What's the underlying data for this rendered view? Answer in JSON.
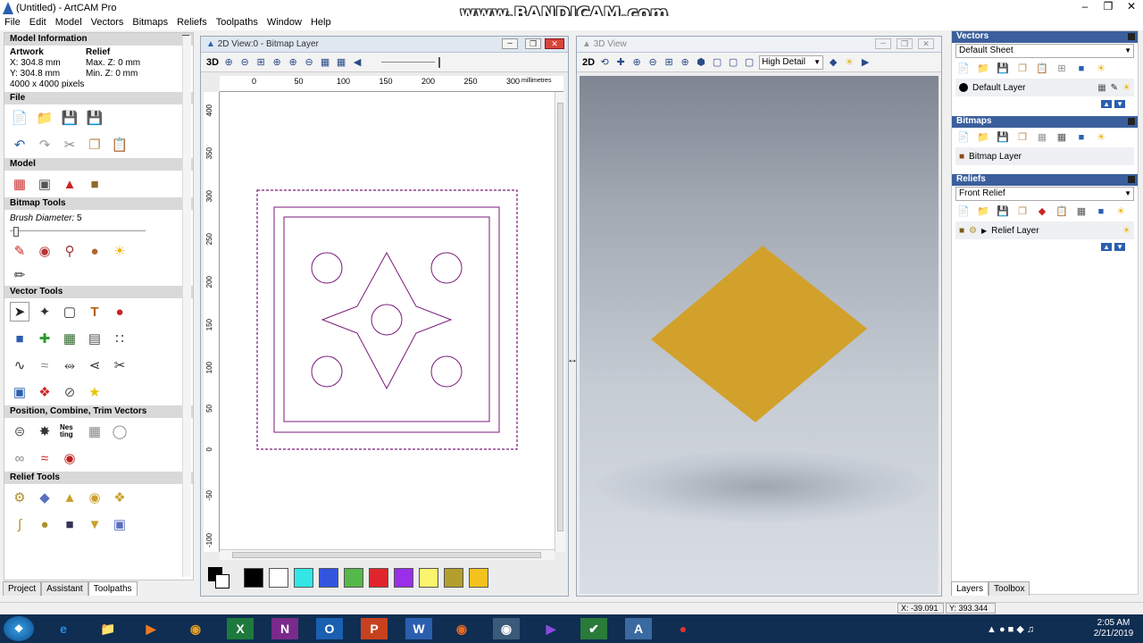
{
  "window": {
    "title": "(Untitled) - ArtCAM Pro",
    "watermark": "www.BANDICAM.com"
  },
  "menu": [
    "File",
    "Edit",
    "Model",
    "Vectors",
    "Bitmaps",
    "Reliefs",
    "Toolpaths",
    "Window",
    "Help"
  ],
  "left_panel": {
    "model_info": {
      "heading": "Model Information",
      "artwork_label": "Artwork",
      "relief_label": "Relief",
      "x": "X: 304.8 mm",
      "max_z": "Max. Z: 0 mm",
      "y": "Y: 304.8 mm",
      "min_z": "Min. Z: 0 mm",
      "pixels": "4000 x 4000 pixels"
    },
    "file_heading": "File",
    "model_heading": "Model",
    "bitmap_tools_heading": "Bitmap Tools",
    "brush_label": "Brush Diameter:",
    "brush_value": "5",
    "vector_tools_heading": "Vector Tools",
    "position_heading": "Position, Combine, Trim Vectors",
    "nesting_label": "Nes ting",
    "relief_tools_heading": "Relief Tools",
    "tabs": [
      "Project",
      "Assistant",
      "Toolpaths"
    ]
  },
  "view2d": {
    "title": "2D View:0 - Bitmap Layer",
    "toolbar_label": "3D",
    "ruler_x": [
      "0",
      "50",
      "100",
      "150",
      "200",
      "250",
      "300"
    ],
    "ruler_unit": "millimetres",
    "ruler_y": [
      "400",
      "350",
      "300",
      "250",
      "200",
      "150",
      "100",
      "50",
      "0",
      "-50",
      "-100"
    ],
    "palette": [
      "#000000",
      "#ffffff",
      "#33e6e6",
      "#3355dd",
      "#55b84a",
      "#e0262c",
      "#9b2ee8",
      "#fbf56d",
      "#b39f2e",
      "#f4c21c"
    ]
  },
  "view3d": {
    "title": "3D View",
    "toolbar_label": "2D",
    "quality": "High Detail",
    "relief_color": "#d1a12b"
  },
  "right_panel": {
    "vectors_heading": "Vectors",
    "vectors_sheet": "Default Sheet",
    "vector_layer": "Default Layer",
    "bitmaps_heading": "Bitmaps",
    "bitmap_layer": "Bitmap Layer",
    "reliefs_heading": "Reliefs",
    "reliefs_sheet": "Front Relief",
    "relief_layer": "Relief Layer",
    "tabs": [
      "Layers",
      "Toolbox"
    ]
  },
  "status": {
    "x": "X: -39.091",
    "y": "Y: 393.344"
  },
  "taskbar": {
    "time": "2:05 AM",
    "date": "2/21/2019"
  }
}
